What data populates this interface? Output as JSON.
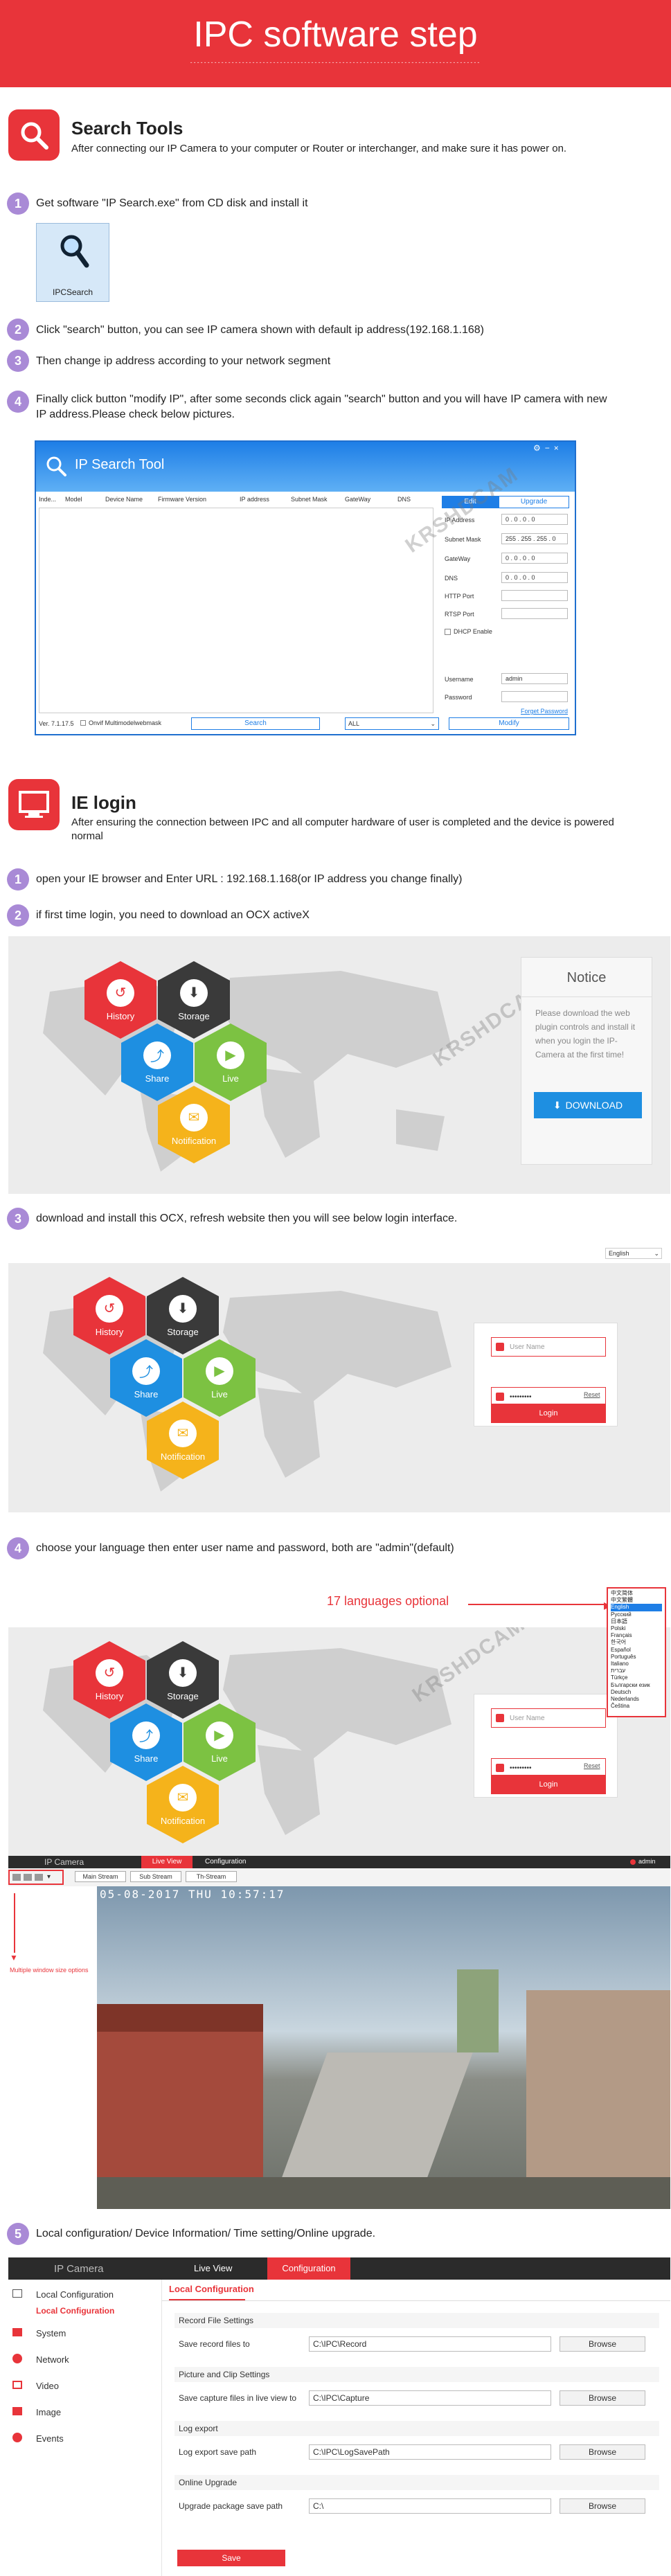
{
  "banner": {
    "title": "IPC software step",
    "subtitle": "------------------------------------------------------------------------------------"
  },
  "search_tools": {
    "title": "Search Tools",
    "desc": "After connecting our IP Camera to your computer or  Router or interchanger, and make sure it has power on.",
    "steps": [
      {
        "num": "1",
        "text": "Get software \"IP Search.exe\" from CD disk and install it"
      },
      {
        "num": "2",
        "text": "Click \"search\" button, you can see IP camera shown with default ip address(192.168.1.168)"
      },
      {
        "num": "3",
        "text": "Then change ip address according to your network segment"
      },
      {
        "num": "4",
        "text": "Finally click button \"modify IP\", after some seconds click again \"search\" button and you will have IP camera with new IP address.Please check below pictures."
      }
    ],
    "app_icon_label": "IPCSearch"
  },
  "ip_search_tool": {
    "title": "IP Search Tool",
    "columns": [
      "Inde...",
      "Model",
      "Device Name",
      "Firmware Version",
      "IP address",
      "Subnet Mask",
      "GateWay",
      "DNS"
    ],
    "tabs": [
      "Edit",
      "Upgrade"
    ],
    "fields": [
      {
        "label": "IP Address",
        "value": "0 . 0 . 0 . 0"
      },
      {
        "label": "Subnet Mask",
        "value": "255 . 255 . 255 . 0"
      },
      {
        "label": "GateWay",
        "value": "0 . 0 . 0 . 0"
      },
      {
        "label": "DNS",
        "value": "0 . 0 . 0 . 0"
      },
      {
        "label": "HTTP Port",
        "value": ""
      },
      {
        "label": "RTSP Port",
        "value": ""
      }
    ],
    "dhcp": "DHCP Enable",
    "username_label": "Username",
    "username_value": "admin",
    "password_label": "Password",
    "forget_password": "Forget Password",
    "version": "Ver. 7.1.17.5",
    "onvif": "Onvif Multimodelwebmask",
    "search_btn": "Search",
    "filter": "ALL",
    "modify_btn": "Modify",
    "watermark": "KRSHDCAM"
  },
  "ie_login": {
    "title": "IE login",
    "desc": "After ensuring the connection between IPC and all computer hardware of user is completed and the device is powered normal",
    "steps": [
      {
        "num": "1",
        "text": "open your IE browser and Enter URL : 192.168.1.168(or IP address you change finally)"
      },
      {
        "num": "2",
        "text": "if first time login, you need to download an OCX activeX"
      },
      {
        "num": "3",
        "text": "download and install this OCX, refresh website then you will see below login interface."
      },
      {
        "num": "4",
        "text": "choose your language then enter user name and password, both are \"admin\"(default)"
      },
      {
        "num": "5",
        "text": "Local configuration/ Device Information/ Time setting/Online upgrade."
      }
    ]
  },
  "hexes": [
    {
      "label": "History",
      "color": "#e8343a",
      "icon": "history-icon"
    },
    {
      "label": "Storage",
      "color": "#3a3a3a",
      "icon": "storage-icon"
    },
    {
      "label": "Share",
      "color": "#1e8fe1",
      "icon": "share-icon"
    },
    {
      "label": "Live",
      "color": "#7cc242",
      "icon": "live-icon"
    },
    {
      "label": "Notification",
      "color": "#f5b31b",
      "icon": "notification-icon"
    }
  ],
  "notice": {
    "title": "Notice",
    "body": "Please download the web plugin controls and install it when you login the IP-Camera at the first time!",
    "download": "DOWNLOAD"
  },
  "login_panel": {
    "language": "English",
    "username_placeholder": "User Name",
    "password_dots": "•••••••••",
    "reset": "Reset",
    "login": "Login"
  },
  "languages_panel": {
    "callout": "17 languages optional",
    "list": [
      "中文简体",
      "中文繁體",
      "English",
      "Русский",
      "日本語",
      "Polski",
      "Français",
      "한국어",
      "Español",
      "Português",
      "Italiano",
      "עברית",
      "Türkçe",
      "Български език",
      "Deutsch",
      "Nederlands",
      "Čeština"
    ]
  },
  "live_view": {
    "brand": "IP Camera",
    "nav": [
      "Live View",
      "Configuration"
    ],
    "user": "admin",
    "streams": [
      "Main Stream",
      "Sub Stream",
      "Th-Stream"
    ],
    "timestamp": "05-08-2017 THU 10:57:17",
    "multi_window_note": "Multiple window size options"
  },
  "config": {
    "brand": "IP Camera",
    "nav": [
      "Live View",
      "Configuration"
    ],
    "sidebar": [
      "Local Configuration",
      "System",
      "Network",
      "Video",
      "Image",
      "Events"
    ],
    "sidebar_active": "Local Configuration",
    "tab": "Local Configuration",
    "sections": [
      {
        "title": "Record File Settings",
        "rows": [
          {
            "label": "Save record files to",
            "value": "C:\\IPC\\Record",
            "btn": "Browse"
          }
        ]
      },
      {
        "title": "Picture and Clip Settings",
        "rows": [
          {
            "label": "Save capture files in live view to",
            "value": "C:\\IPC\\Capture",
            "btn": "Browse"
          }
        ]
      },
      {
        "title": "Log export",
        "rows": [
          {
            "label": "Log export save path",
            "value": "C:\\IPC\\LogSavePath",
            "btn": "Browse"
          }
        ]
      },
      {
        "title": "Online Upgrade",
        "rows": [
          {
            "label": "Upgrade package save path",
            "value": "C:\\",
            "btn": "Browse"
          }
        ]
      }
    ],
    "save": "Save"
  }
}
